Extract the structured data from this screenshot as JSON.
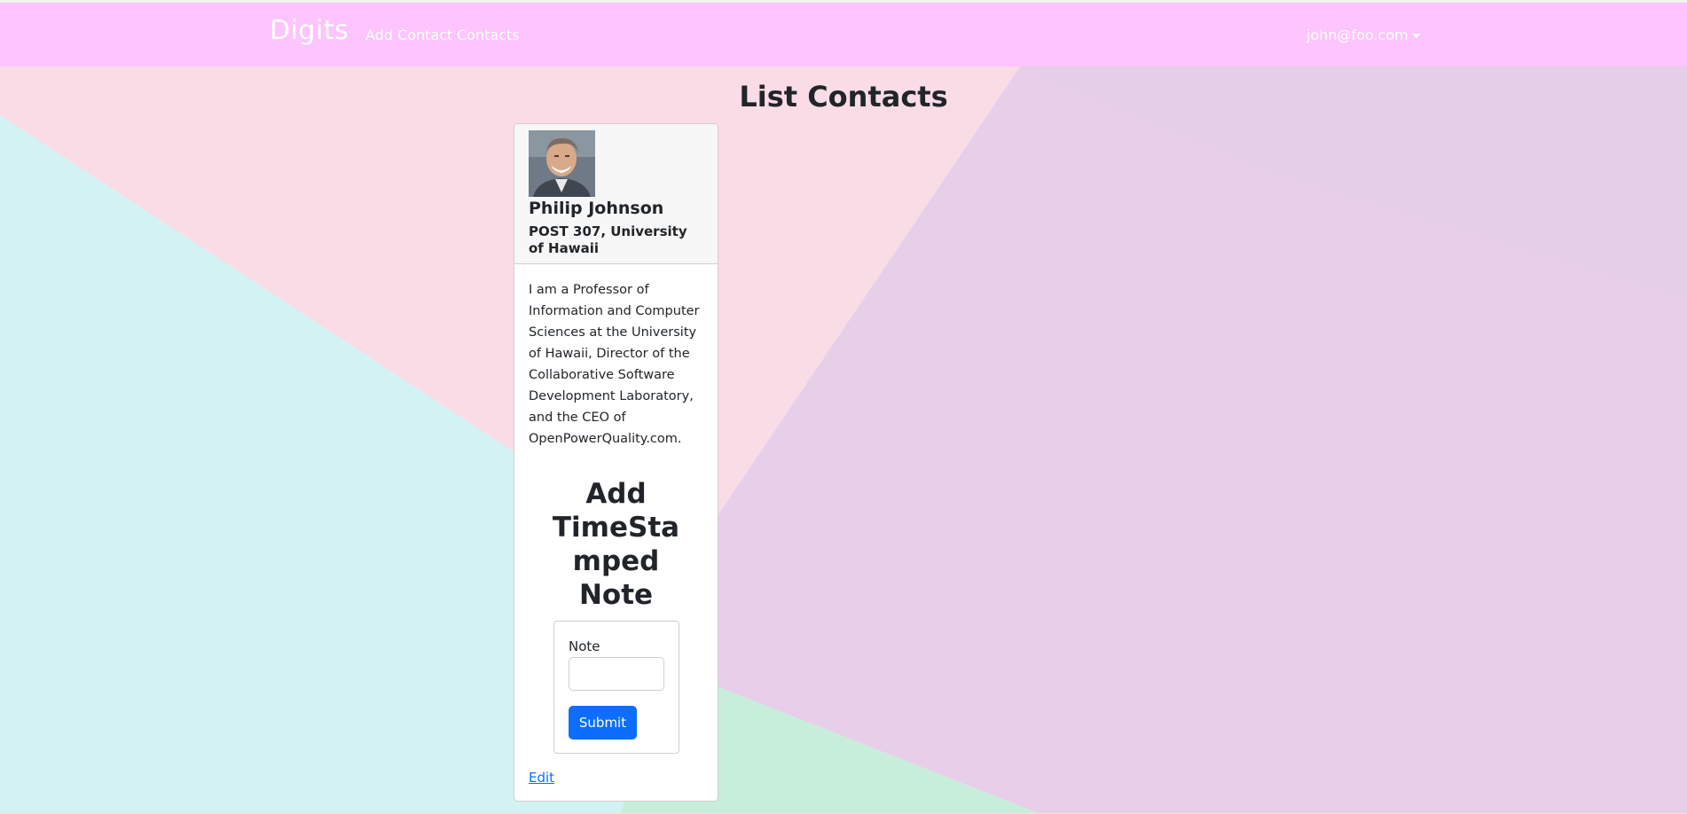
{
  "navbar": {
    "brand": "Digits",
    "links": [
      "Add Contact",
      "Contacts"
    ],
    "user": "john@foo.com",
    "background": "#fdc4fd"
  },
  "main": {
    "title": "List Contacts"
  },
  "contact": {
    "name": "Philip Johnson",
    "address": "POST 307, University of Hawaii",
    "bio": "I am a Professor of Information and Computer Sciences at the University of Hawaii, Director of the Collaborative Software Development Laboratory, and the CEO of OpenPowerQuality.com.",
    "note_form": {
      "title": "Add TimeStamped Note",
      "label": "Note",
      "value": "",
      "submit_label": "Submit"
    },
    "edit_label": "Edit"
  },
  "colors": {
    "accent": "#0d6efd",
    "background_pink": "#f9dce6",
    "background_cyan": "#d3f2f3",
    "background_lavender": "#e8cfe9",
    "background_green": "#c7eedb"
  }
}
